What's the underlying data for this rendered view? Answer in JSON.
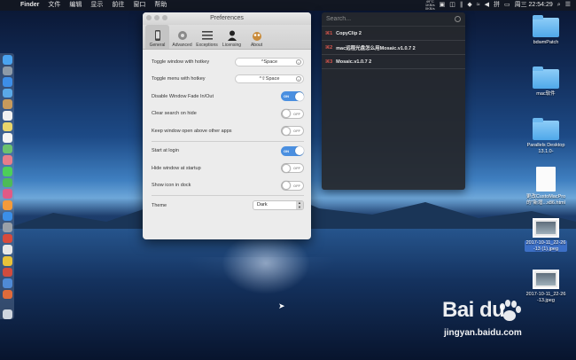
{
  "menubar": {
    "app_name": "Finder",
    "menus": [
      "文件",
      "编辑",
      "显示",
      "前往",
      "窗口",
      "帮助"
    ],
    "stats": [
      "49°C",
      "1KB/s",
      "0KB/s"
    ],
    "datetime": "周三 22:54:29"
  },
  "preferences": {
    "title": "Preferences",
    "tabs": [
      {
        "label": "General",
        "icon": "phone-icon"
      },
      {
        "label": "Advanced",
        "icon": "gear-icon"
      },
      {
        "label": "Exceptions",
        "icon": "list-icon"
      },
      {
        "label": "Licensing",
        "icon": "person-icon"
      },
      {
        "label": "About",
        "icon": "owl-icon"
      }
    ],
    "active_tab": "General",
    "rows": {
      "toggle_window_label": "Toggle window with hotkey",
      "toggle_window_value": "^Space",
      "toggle_menu_label": "Toggle menu with hotkey",
      "toggle_menu_value": "^⇧Space",
      "disable_fade_label": "Disable Window Fade In/Out",
      "disable_fade_state": "ON",
      "clear_search_label": "Clear search on hide",
      "clear_search_state": "OFF",
      "keep_window_label": "Keep window open above other apps",
      "keep_window_state": "OFF",
      "start_login_label": "Start at login",
      "start_login_state": "ON",
      "hide_startup_label": "Hide window at startup",
      "hide_startup_state": "OFF",
      "show_dock_label": "Show icon in dock",
      "show_dock_state": "OFF",
      "theme_label": "Theme",
      "theme_value": "Dark"
    }
  },
  "clipboard": {
    "search_placeholder": "Search...",
    "items": [
      {
        "key": "⌘1",
        "text": "CopyClip 2"
      },
      {
        "key": "⌘2",
        "text": "mac远程光盘怎么用Mosaic.v1.0.7 2"
      },
      {
        "key": "⌘3",
        "text": "Mosaic.v1.0.7 2"
      }
    ]
  },
  "desktop": {
    "icons": [
      {
        "label": "bdwmPatch",
        "type": "folder"
      },
      {
        "label": "mac软件",
        "type": "folder"
      },
      {
        "label": "Parallels Desktop\n13.1.0-",
        "type": "folder"
      },
      {
        "label": "更改CustoMacPro\n的\"新增...x86.html",
        "type": "document"
      },
      {
        "label": "2017-10-11_22-26\n-13 (1).jpeg",
        "type": "image"
      },
      {
        "label": "2017-10-11_22-26\n-13.jpeg",
        "type": "image"
      }
    ]
  },
  "watermark": {
    "logo": "Bai du",
    "url": "jingyan.baidu.com"
  }
}
